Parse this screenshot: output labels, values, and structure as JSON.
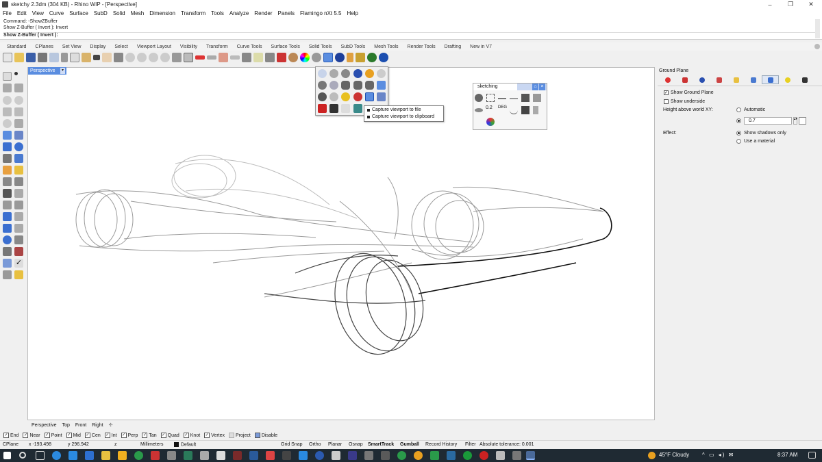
{
  "window": {
    "title": "sketchy 2.3dm (304 KB) - Rhino WIP - [Perspective]",
    "minimize_glyph": "–",
    "maximize_glyph": "❐",
    "close_glyph": "✕"
  },
  "menu": [
    "File",
    "Edit",
    "View",
    "Curve",
    "Surface",
    "SubD",
    "Solid",
    "Mesh",
    "Dimension",
    "Transform",
    "Tools",
    "Analyze",
    "Render",
    "Panels",
    "Flamingo nXt 5.5",
    "Help"
  ],
  "command_history": [
    "Command: -ShowZBuffer",
    "Show Z-Buffer ( Invert ): Invert"
  ],
  "command_prompt": "Show Z-Buffer ( Invert ):",
  "toolbar_tabs": [
    "Standard",
    "CPlanes",
    "Set View",
    "Display",
    "Select",
    "Viewport Layout",
    "Visibility",
    "Transform",
    "Curve Tools",
    "Surface Tools",
    "Solid Tools",
    "SubD Tools",
    "Mesh Tools",
    "Render Tools",
    "Drafting",
    "New in V7"
  ],
  "active_toolbar_tab": "Standard",
  "viewport": {
    "active_view": "Perspective",
    "dropdown_glyph": "▾",
    "view_tabs": [
      "Perspective",
      "Top",
      "Front",
      "Right"
    ],
    "add_view_glyph": "✣"
  },
  "tooltip": {
    "items": [
      "Capture viewport to file",
      "Capture viewport to clipboard"
    ]
  },
  "sketching_toolbar": {
    "title": "sketching",
    "pin_glyph": "⌂",
    "close_glyph": "×",
    "label_02": "0.2",
    "label_deg": "DEG"
  },
  "right_panel": {
    "title": "Ground Plane",
    "show_ground_plane": {
      "label": "Show Ground Plane",
      "checked": true
    },
    "show_underside": {
      "label": "Show underside",
      "checked": false
    },
    "height_label": "Height above world XY:",
    "height_automatic": "Automatic",
    "height_value": "0.7",
    "effect_label": "Effect:",
    "effect_options": [
      "Show shadows only",
      "Use a material"
    ],
    "effect_selected": "Show shadows only"
  },
  "osnaps": [
    {
      "label": "End",
      "checked": true
    },
    {
      "label": "Near",
      "checked": true
    },
    {
      "label": "Point",
      "checked": true
    },
    {
      "label": "Mid",
      "checked": true
    },
    {
      "label": "Cen",
      "checked": true
    },
    {
      "label": "Int",
      "checked": true
    },
    {
      "label": "Perp",
      "checked": true
    },
    {
      "label": "Tan",
      "checked": true
    },
    {
      "label": "Quad",
      "checked": true
    },
    {
      "label": "Knot",
      "checked": true
    },
    {
      "label": "Vertex",
      "checked": true
    },
    {
      "label": "Project",
      "checked": false
    },
    {
      "label": "Disable",
      "checked": false
    }
  ],
  "status": {
    "cplane": "CPlane",
    "x": "x -193.498",
    "y": "y 296.942",
    "z": "z",
    "units": "Millimeters",
    "layer": "Default",
    "toggles": [
      "Grid Snap",
      "Ortho",
      "Planar",
      "Osnap",
      "SmartTrack",
      "Gumball",
      "Record History",
      "Filter"
    ],
    "bold_toggles": [
      "SmartTrack",
      "Gumball"
    ],
    "tolerance": "Absolute tolerance: 0.001"
  },
  "taskbar": {
    "weather": "45°F  Cloudy",
    "tray_glyphs": "^ ▭ ◂) ✉",
    "time": "8:37 AM"
  },
  "colors": {
    "accent": "#5a8de0",
    "taskbar": "#1f2a33"
  }
}
